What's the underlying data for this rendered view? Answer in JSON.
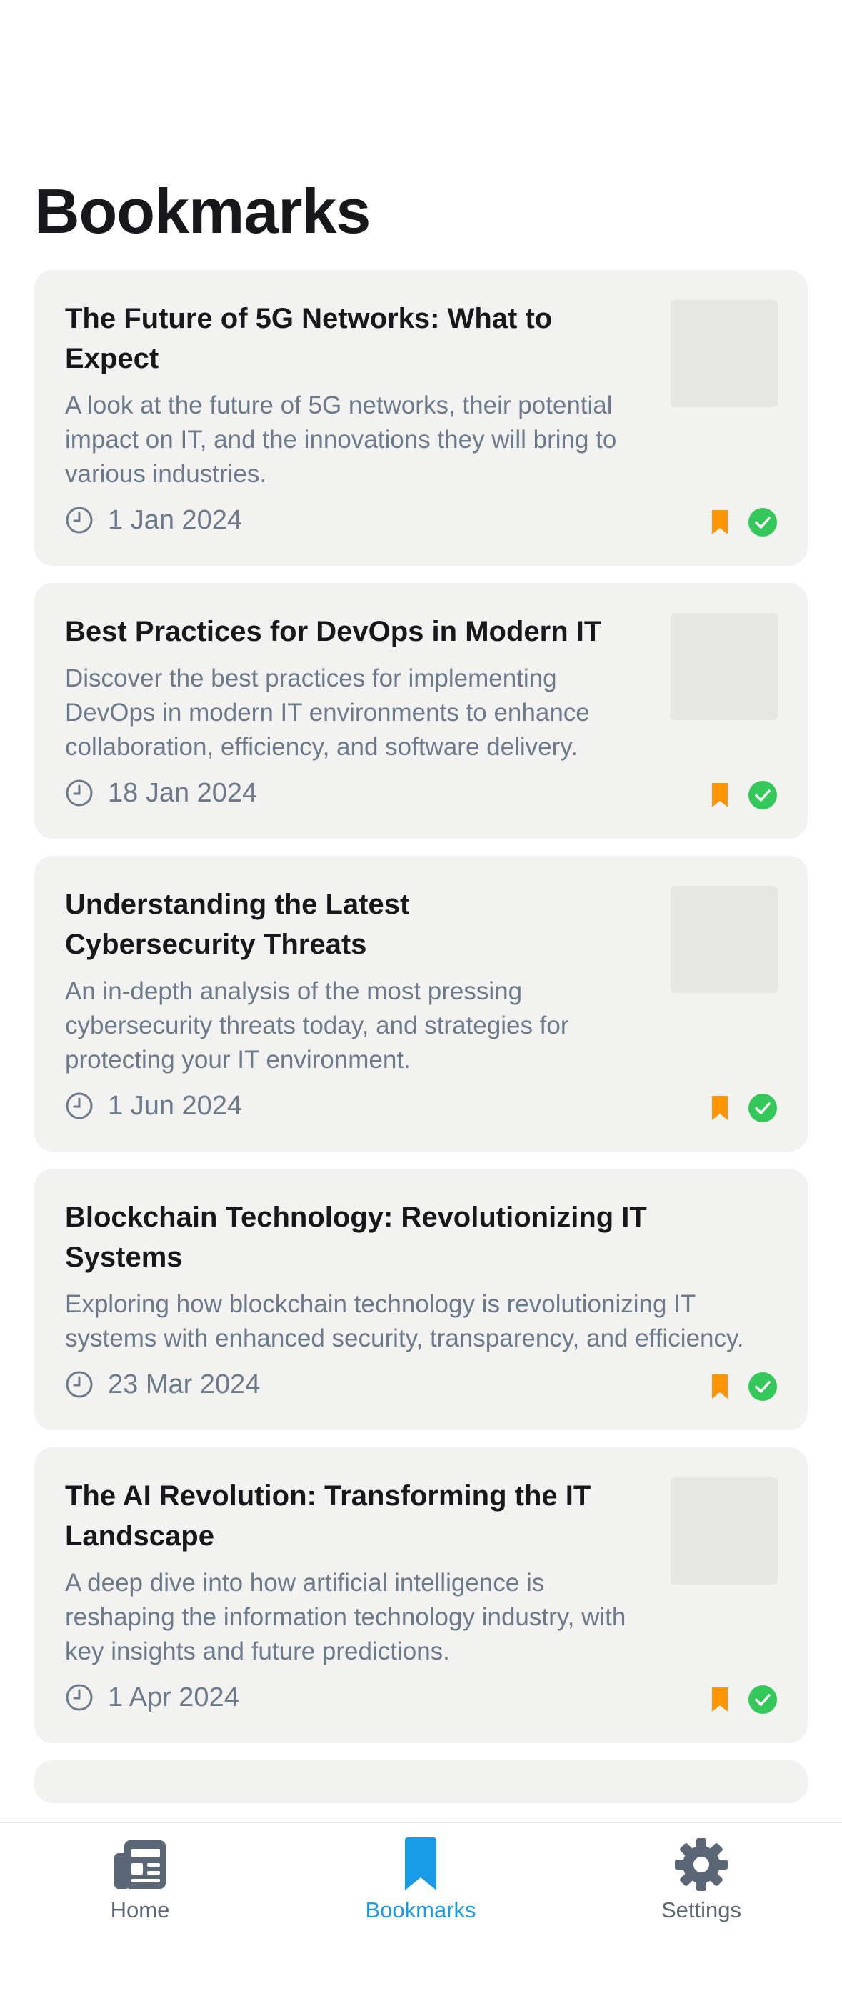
{
  "page": {
    "title": "Bookmarks"
  },
  "articles": [
    {
      "title": "The Future of 5G Networks: What to Expect",
      "description": "A look at the future of 5G networks, their potential impact on IT, and the innovations they will bring to various industries.",
      "date": "1 Jan 2024"
    },
    {
      "title": "Best Practices for DevOps in Modern IT",
      "description": "Discover the best practices for implementing DevOps in modern IT environments to enhance collaboration, efficiency, and software delivery.",
      "date": "18 Jan 2024"
    },
    {
      "title": "Understanding the Latest Cybersecurity Threats",
      "description": "An in-depth analysis of the most pressing cybersecurity threats today, and strategies for protecting your IT environment.",
      "date": "1 Jun 2024"
    },
    {
      "title": "Blockchain Technology: Revolutionizing IT Systems",
      "description": "Exploring how blockchain technology is revolutionizing IT systems with enhanced security, transparency, and efficiency.",
      "date": "23 Mar 2024"
    },
    {
      "title": "The AI Revolution: Transforming the IT Landscape",
      "description": "A deep dive into how artificial intelligence is reshaping the information technology industry, with key insights and future predictions.",
      "date": "1 Apr 2024"
    }
  ],
  "tabs": {
    "home": {
      "label": "Home",
      "icon": "newspaper-icon"
    },
    "bookmarks": {
      "label": "Bookmarks",
      "icon": "bookmark-icon"
    },
    "settings": {
      "label": "Settings",
      "icon": "gear-icon"
    }
  },
  "colors": {
    "accent": "#1a9be8",
    "bookmark": "#ff9500",
    "read_check": "#34c759",
    "card_bg": "#f2f2f1",
    "muted_text": "#6c7a8a",
    "tab_inactive": "#5b6776"
  }
}
